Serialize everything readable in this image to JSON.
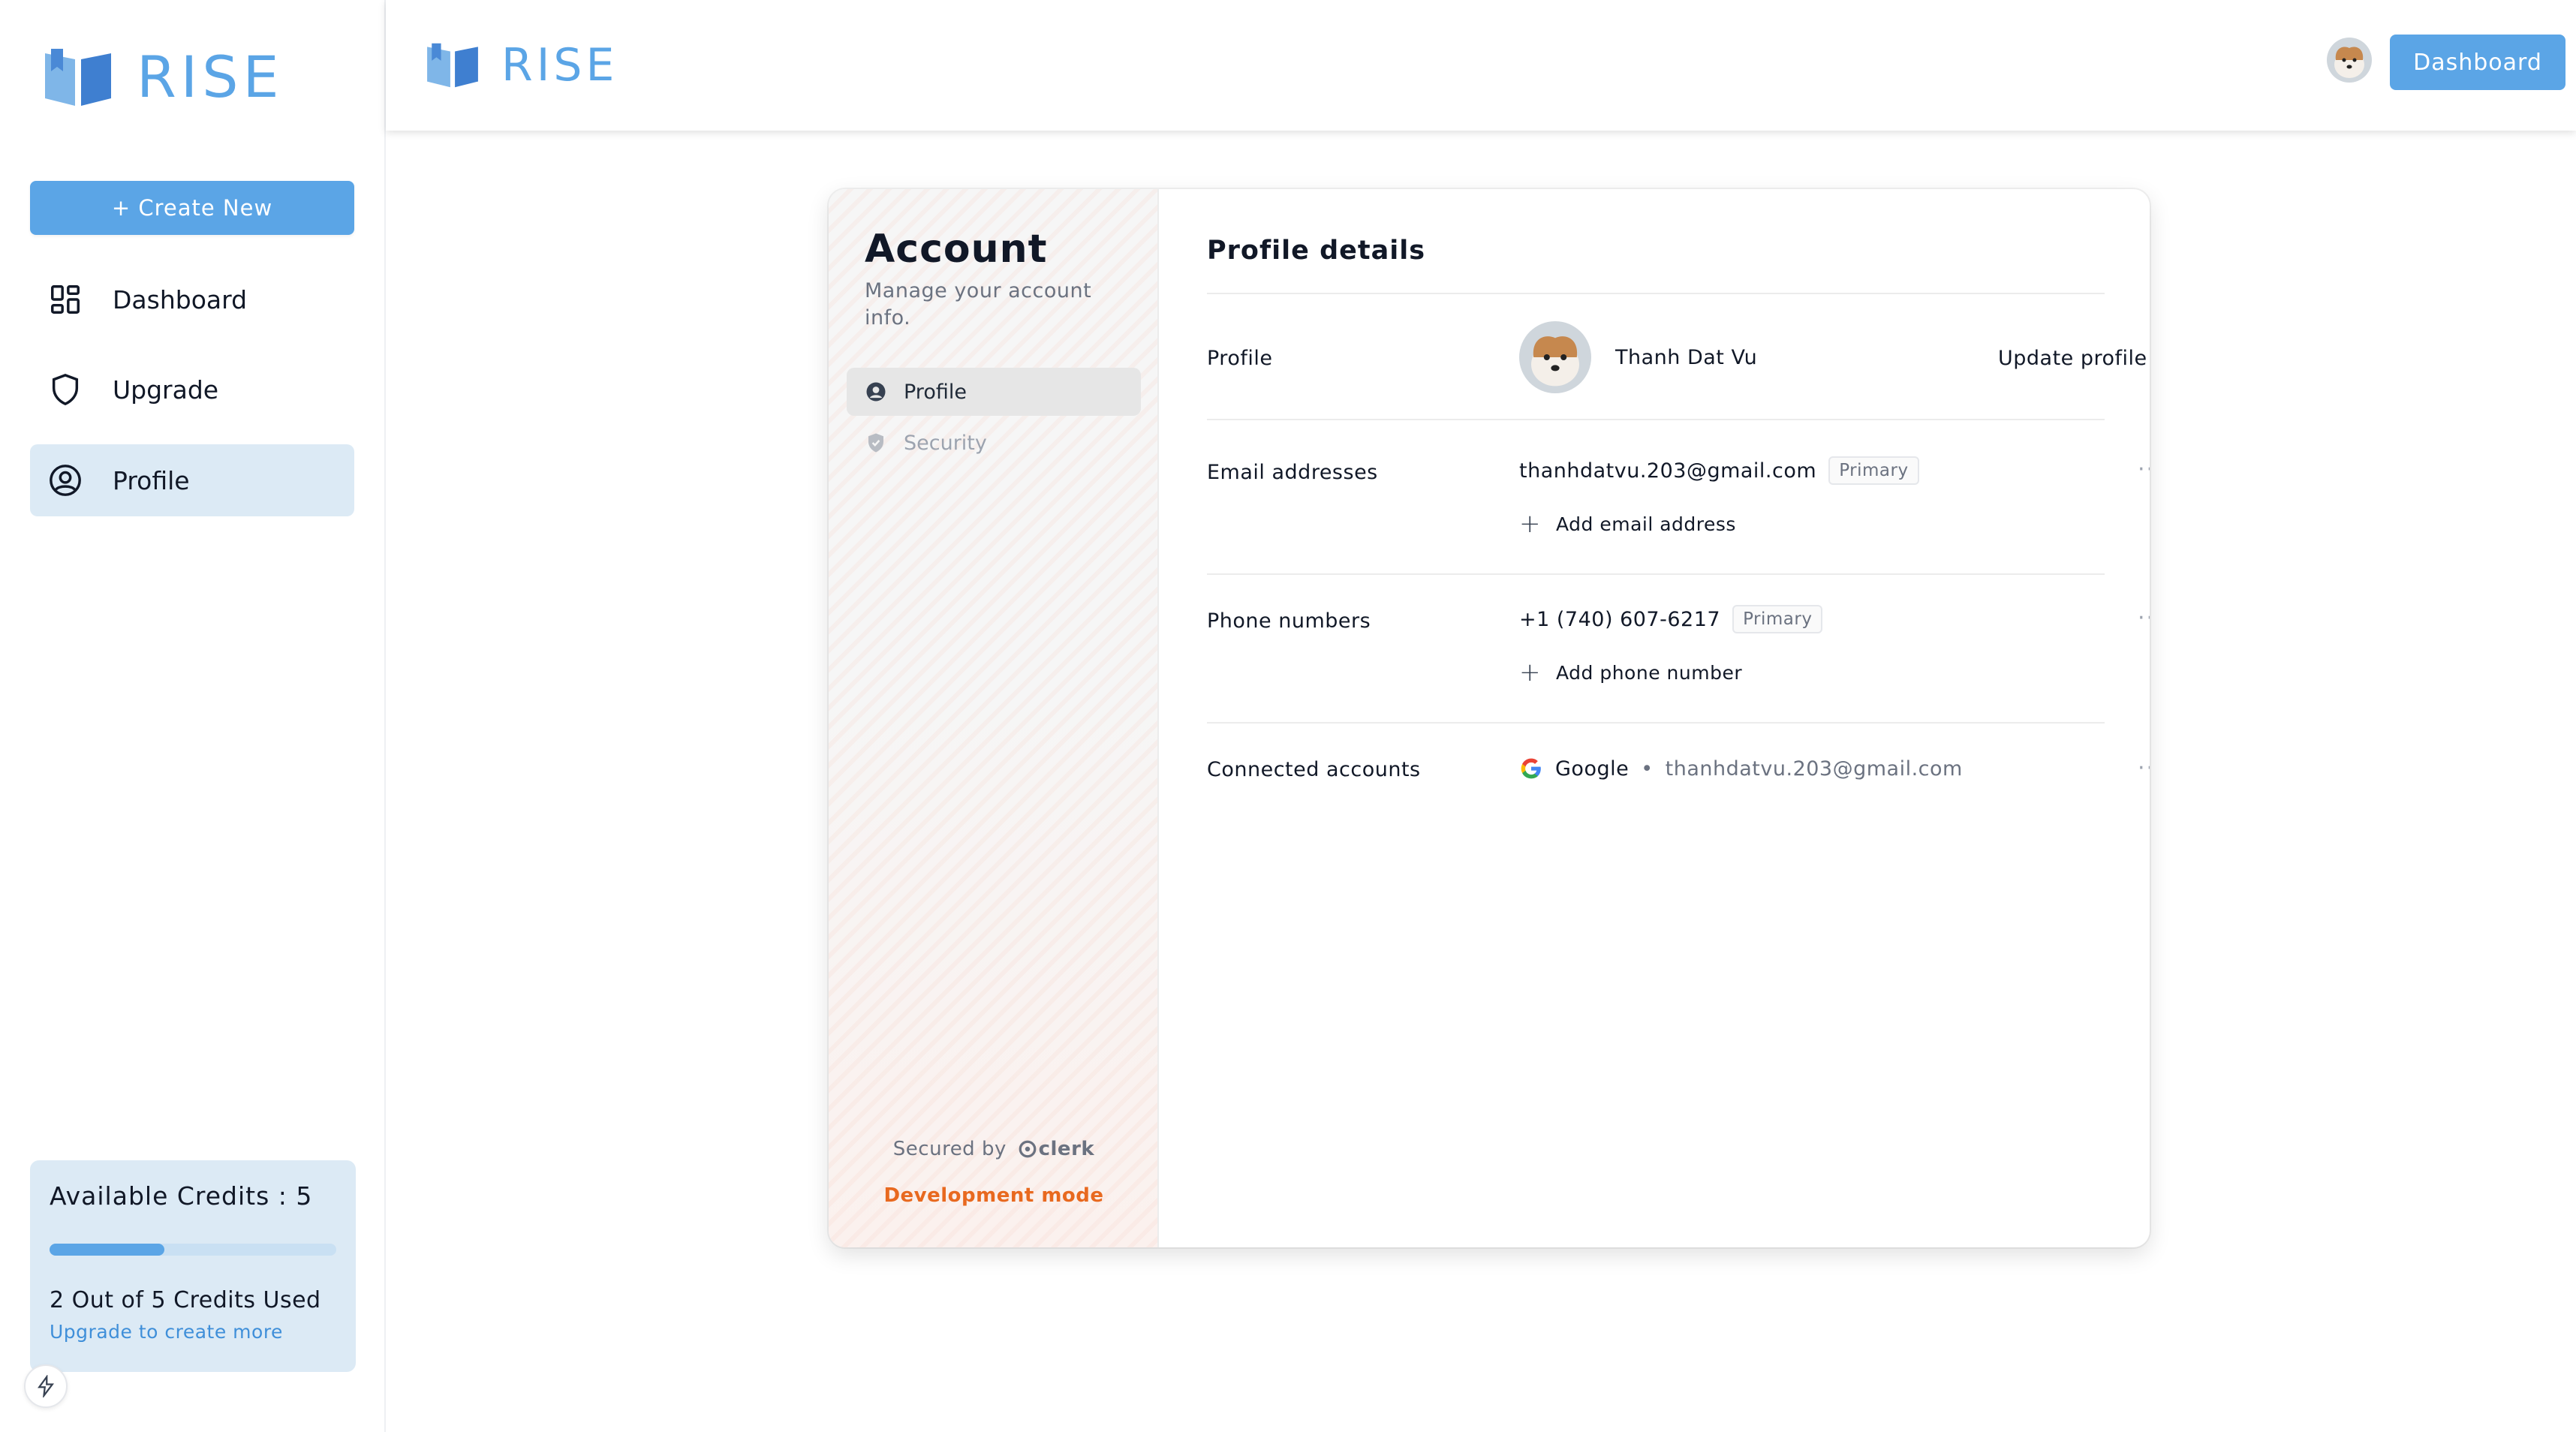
{
  "brand": {
    "name": "RISE",
    "accent": "#5ba5e6"
  },
  "sidebar": {
    "create_label": "+ Create New",
    "items": [
      {
        "label": "Dashboard",
        "icon": "grid-icon"
      },
      {
        "label": "Upgrade",
        "icon": "shield-icon"
      },
      {
        "label": "Profile",
        "icon": "user-circle-icon"
      }
    ],
    "credits": {
      "title": "Available Credits : 5",
      "used_text": "2 Out of 5 Credits Used",
      "upgrade_link": "Upgrade to create more",
      "progress": 0.4
    }
  },
  "topbar": {
    "dashboard_button": "Dashboard"
  },
  "account": {
    "title": "Account",
    "subtitle": "Manage your account info.",
    "nav": [
      {
        "label": "Profile",
        "icon": "user-circle-icon"
      },
      {
        "label": "Security",
        "icon": "shield-check-icon"
      }
    ],
    "secured_by": "Secured by",
    "clerk": "clerk",
    "dev_mode": "Development mode"
  },
  "profile": {
    "title": "Profile details",
    "profile_label": "Profile",
    "name": "Thanh Dat Vu",
    "update_label": "Update profile",
    "email_label": "Email addresses",
    "email": "thanhdatvu.203@gmail.com",
    "primary": "Primary",
    "add_email": "Add email address",
    "phone_label": "Phone numbers",
    "phone": "+1 (740) 607-6217",
    "add_phone": "Add phone number",
    "connected_label": "Connected accounts",
    "connected_provider": "Google",
    "connected_sep": "•",
    "connected_email": "thanhdatvu.203@gmail.com",
    "more": "···"
  }
}
